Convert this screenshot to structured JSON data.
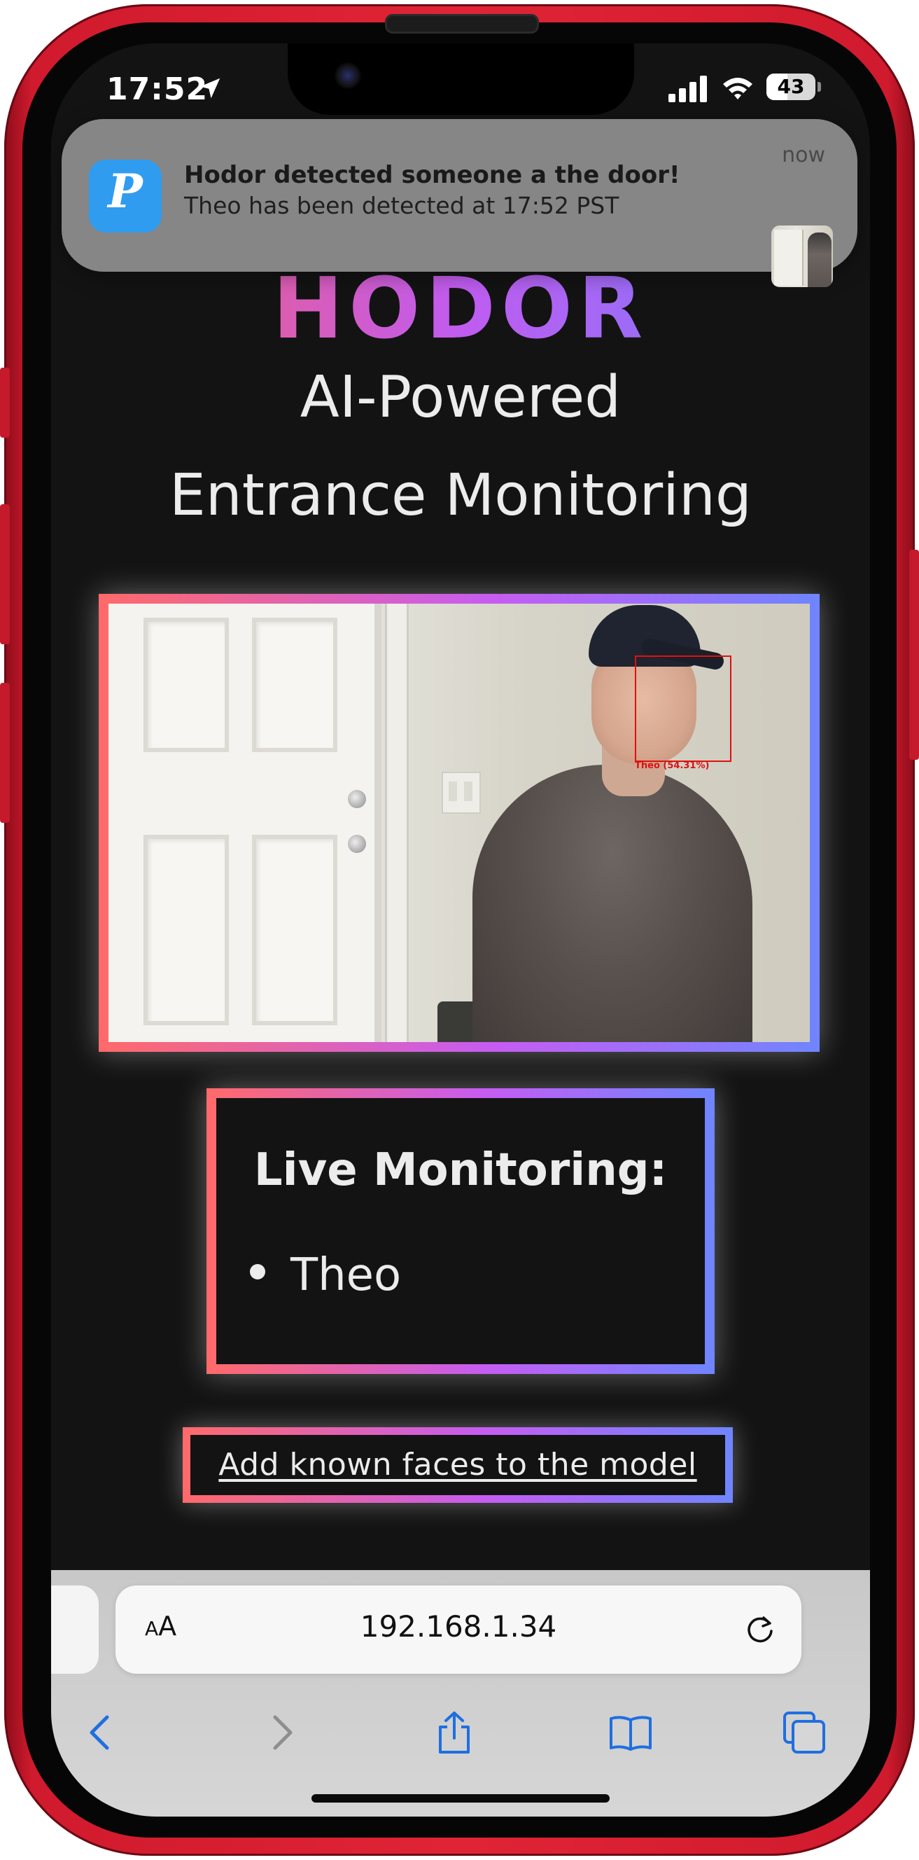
{
  "status_bar": {
    "time": "17:52",
    "battery": "43",
    "battery_level": 0.43
  },
  "notification": {
    "app_icon_letter": "P",
    "title": "Hodor detected someone a the door!",
    "body": "Theo has been detected at 17:52 PST",
    "time": "now"
  },
  "page": {
    "title": "HODOR",
    "subtitle_line1": "AI-Powered",
    "subtitle_line2": "Entrance Monitoring",
    "video": {
      "detection_label": "Theo (54.31%)"
    },
    "live_monitoring": {
      "heading": "Live Monitoring:",
      "items": [
        "Theo"
      ]
    },
    "link_label": "Add known faces to the model"
  },
  "browser": {
    "text_size_label": "AA",
    "url": "192.168.1.34"
  },
  "colors": {
    "gradient_start": "#ff6a6a",
    "gradient_mid": "#c65cf2",
    "gradient_end": "#6f85ff",
    "page_background": "#131313",
    "safari_blue": "#1f6fe0",
    "phone_red": "#e02436"
  },
  "icons": [
    "location-arrow-icon",
    "cellular-signal-icon",
    "wifi-icon",
    "battery-icon",
    "reload-icon",
    "back-icon",
    "forward-icon",
    "share-icon",
    "bookmarks-icon",
    "tabs-icon"
  ]
}
